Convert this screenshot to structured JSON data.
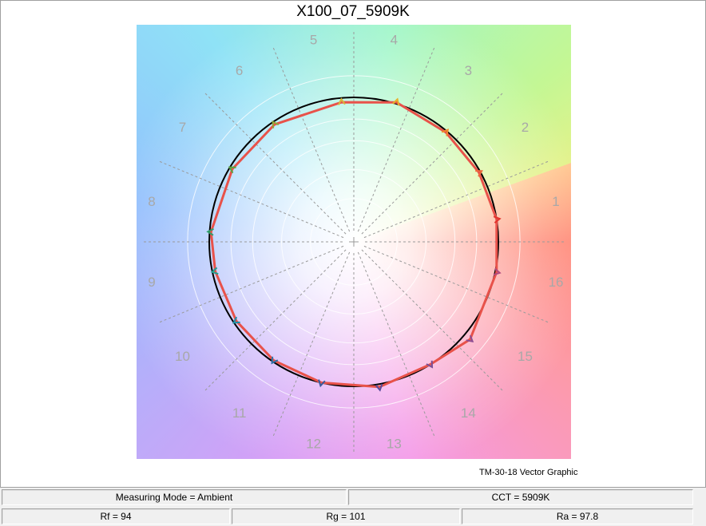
{
  "window": {
    "caption": "TM-30-18 Vector Graphic"
  },
  "status": {
    "measuring_mode": "Measuring Mode = Ambient",
    "cct": "CCT = 5909K",
    "rf": "Rf = 94",
    "rg": "Rg = 101",
    "ra": "Ra = 97.8"
  },
  "colors": {
    "test_line": "#e8524a",
    "reference_circle": "#000000",
    "gridline": "#9a9a9a",
    "bin_label": "#a8a8a8"
  },
  "chart_data": {
    "type": "polar-vector",
    "title": "X100_07_5909K",
    "bins": [
      "1",
      "2",
      "3",
      "4",
      "5",
      "6",
      "7",
      "8",
      "9",
      "10",
      "11",
      "12",
      "13",
      "14",
      "15",
      "16"
    ],
    "bin_label_positions": [
      "1",
      "2",
      "3",
      "4",
      "5",
      "6",
      "7",
      "8",
      "9",
      "10",
      "11",
      "12",
      "13",
      "14",
      "15",
      "16"
    ],
    "reference_radius": 1.0,
    "rings": [
      0.3,
      0.5,
      0.7,
      0.85,
      1.15
    ],
    "grid": true,
    "test_points": [
      {
        "angle_deg": 9,
        "r": 1.0
      },
      {
        "angle_deg": 29,
        "r": 0.99
      },
      {
        "angle_deg": 50,
        "r": 0.99
      },
      {
        "angle_deg": 73,
        "r": 1.01
      },
      {
        "angle_deg": 95,
        "r": 0.97
      },
      {
        "angle_deg": 124,
        "r": 0.98
      },
      {
        "angle_deg": 149,
        "r": 0.98
      },
      {
        "angle_deg": 176,
        "r": 0.99
      },
      {
        "angle_deg": 192,
        "r": 0.98
      },
      {
        "angle_deg": 214,
        "r": 0.98
      },
      {
        "angle_deg": 236,
        "r": 0.99
      },
      {
        "angle_deg": 257,
        "r": 1.0
      },
      {
        "angle_deg": 280,
        "r": 1.02
      },
      {
        "angle_deg": 302,
        "r": 1.0
      },
      {
        "angle_deg": 320,
        "r": 1.05
      },
      {
        "angle_deg": 348,
        "r": 1.01
      }
    ],
    "arrow_colors": [
      "#e2322c",
      "#ee6a3e",
      "#ef8a2a",
      "#e7b028",
      "#d7b63a",
      "#8fa436",
      "#55a33e",
      "#2e9e6b",
      "#22a08e",
      "#1d8fa4",
      "#2f72a7",
      "#3a5a9d",
      "#5a4c9c",
      "#7b4f97",
      "#8d4c92",
      "#b04a7e"
    ]
  }
}
